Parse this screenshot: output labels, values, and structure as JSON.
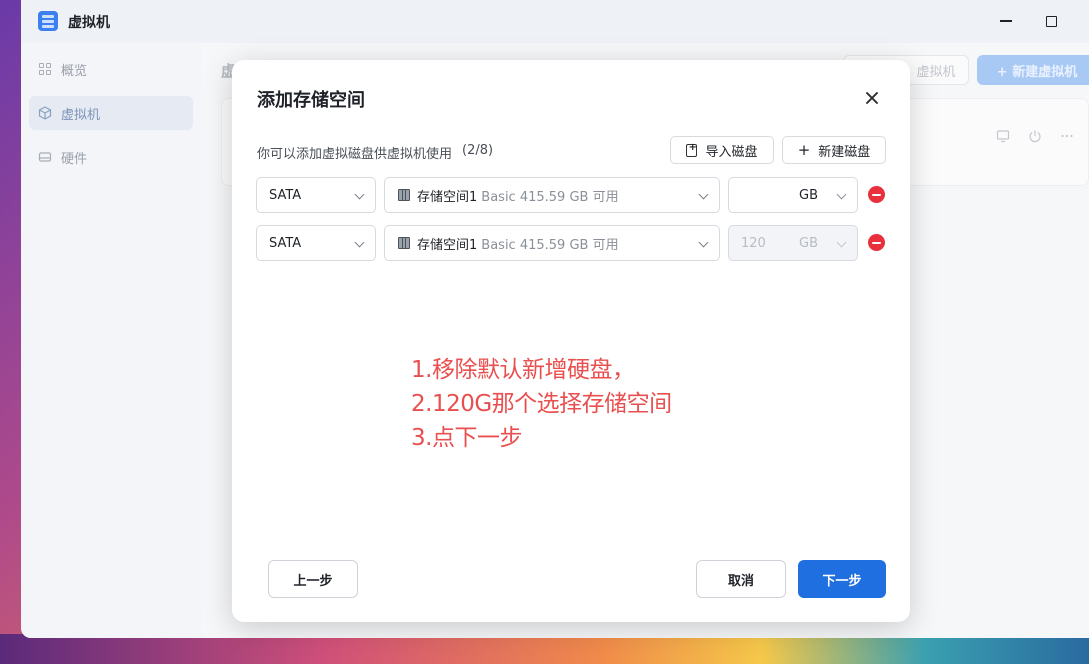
{
  "window": {
    "title": "虚拟机"
  },
  "sidebar": {
    "items": [
      {
        "label": "概览",
        "icon": "grid-icon",
        "active": false
      },
      {
        "label": "虚拟机",
        "icon": "cube-icon",
        "active": true
      },
      {
        "label": "硬件",
        "icon": "drive-icon",
        "active": false
      }
    ]
  },
  "main": {
    "title_fragment": "虚",
    "import_vm_fragment": "虚拟机",
    "new_vm_label": "+ 新建虚拟机"
  },
  "dialog": {
    "title": "添加存储空间",
    "description": "你可以添加虚拟磁盘供虚拟机使用",
    "count": "(2/8)",
    "import_disk_label": "导入磁盘",
    "new_disk_label": "新建磁盘",
    "disks": [
      {
        "type": "SATA",
        "storage_name": "存储空间1",
        "storage_detail": "Basic  415.59 GB 可用",
        "size_value": "",
        "size_unit": "GB",
        "size_disabled": false
      },
      {
        "type": "SATA",
        "storage_name": "存储空间1",
        "storage_detail": "Basic  415.59 GB 可用",
        "size_value": "120",
        "size_unit": "GB",
        "size_disabled": true
      }
    ],
    "annotation_lines": [
      "1.移除默认新增硬盘，",
      "2.120G那个选择存储空间",
      "3.点下一步"
    ],
    "prev_label": "上一步",
    "cancel_label": "取消",
    "next_label": "下一步"
  },
  "colors": {
    "primary": "#1f6fe0",
    "danger": "#e8313d",
    "annotation": "#ea4f4f"
  }
}
